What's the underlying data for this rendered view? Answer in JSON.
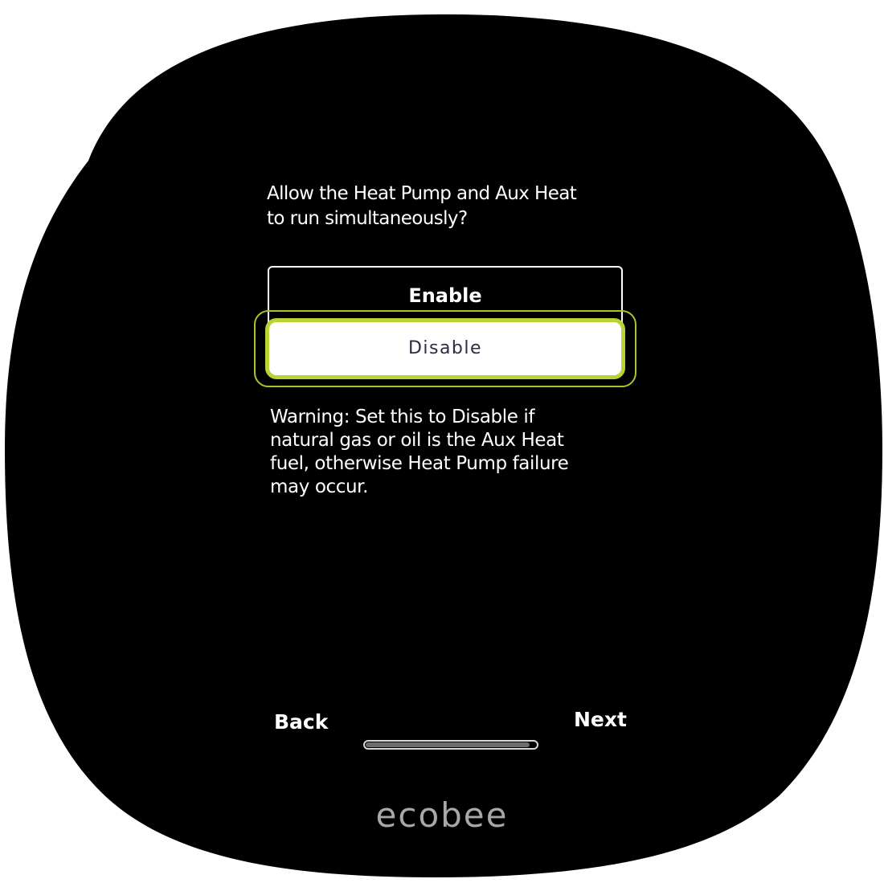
{
  "setting": {
    "question": "Allow the Heat Pump and Aux Heat\nto run simultaneously?",
    "options": [
      {
        "label": "Enable",
        "selected": false
      },
      {
        "label": "Disable",
        "selected": true
      }
    ],
    "warning": "Warning:  Set this to Disable if\nnatural gas or oil is the Aux Heat\nfuel, otherwise Heat Pump failure\nmay occur."
  },
  "navigation": {
    "back_label": "Back",
    "next_label": "Next",
    "progress": 0.96
  },
  "brand": "ecobee",
  "colors": {
    "screen_background": "#000000",
    "focus_highlight": "#b6d432",
    "selected_text": "#2b2c45",
    "brand_text": "#a8a8a8"
  }
}
